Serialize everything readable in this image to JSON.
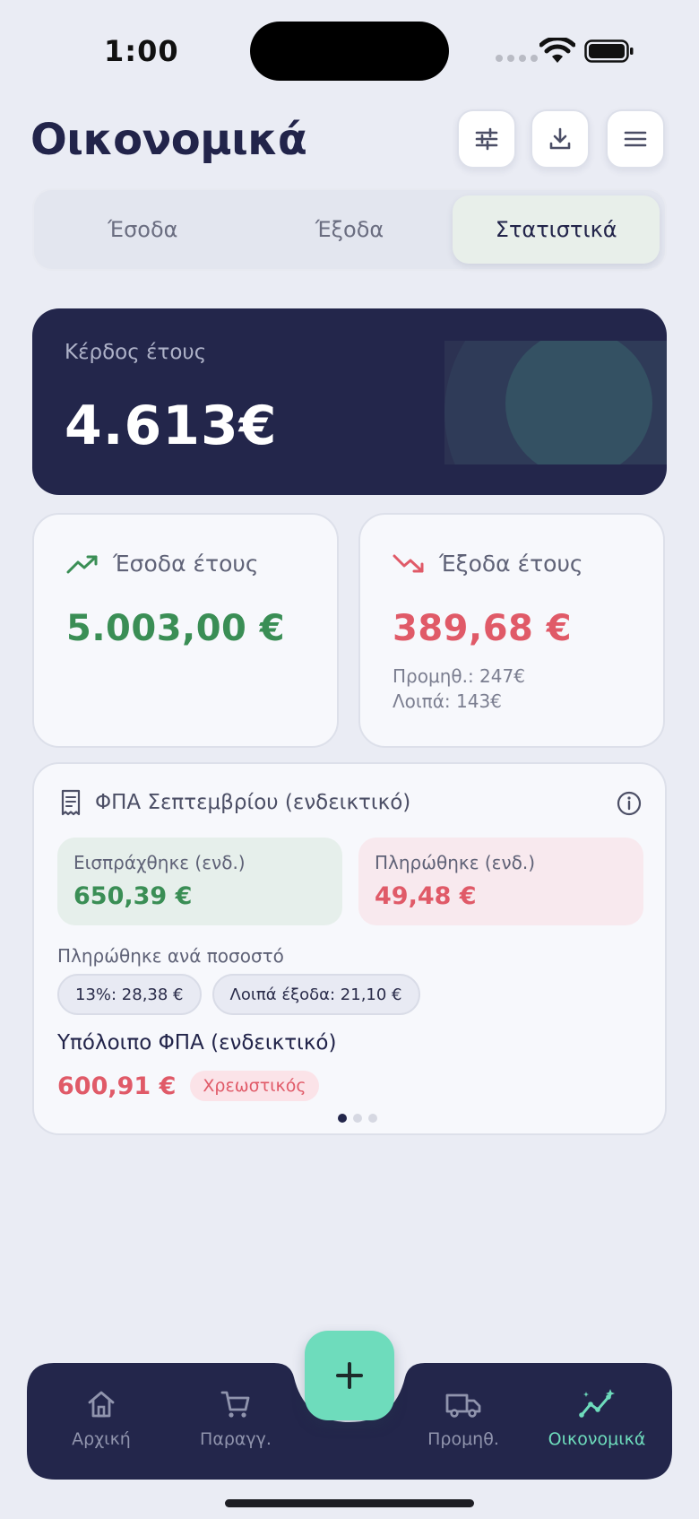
{
  "status": {
    "time": "1:00"
  },
  "header": {
    "title": "Οικονομικά"
  },
  "tabs": [
    {
      "label": "Έσοδα",
      "active": false
    },
    {
      "label": "Έξοδα",
      "active": false
    },
    {
      "label": "Στατιστικά",
      "active": true
    }
  ],
  "profit": {
    "label": "Κέρδος έτους",
    "value": "4.613€"
  },
  "income": {
    "label": "Έσοδα έτους",
    "value": "5.003,00 €"
  },
  "expenses": {
    "label": "Έξοδα έτους",
    "value": "389,68 €",
    "suppliers": "Προμηθ.: 247€",
    "other": "Λοιπά: 143€"
  },
  "vat": {
    "title": "ΦΠΑ Σεπτεμβρίου (ενδεικτικό)",
    "collected_label": "Εισπράχθηκε (ενδ.)",
    "collected_value": "650,39 €",
    "paid_label": "Πληρώθηκε (ενδ.)",
    "paid_value": "49,48 €",
    "rate_title": "Πληρώθηκε ανά ποσοστό",
    "chips": [
      "13%: 28,38 €",
      "Λοιπά έξοδα: 21,10 €"
    ],
    "balance_title": "Υπόλοιπο ΦΠΑ (ενδεικτικό)",
    "balance_value": "600,91 €",
    "balance_status": "Χρεωστικός"
  },
  "nav": {
    "home": "Αρχική",
    "orders": "Παραγγ.",
    "suppliers": "Προμηθ.",
    "finance": "Οικονομικά"
  },
  "colors": {
    "primary_dark": "#23264b",
    "accent": "#6edcbc",
    "positive": "#3a8e55",
    "negative": "#e05a68",
    "background": "#eaecf4"
  },
  "icons": {
    "header": [
      "sliders-icon",
      "download-icon",
      "menu-icon"
    ],
    "nav": [
      "home-icon",
      "cart-icon",
      "plus-icon",
      "truck-icon",
      "chart-sparkle-icon"
    ]
  }
}
